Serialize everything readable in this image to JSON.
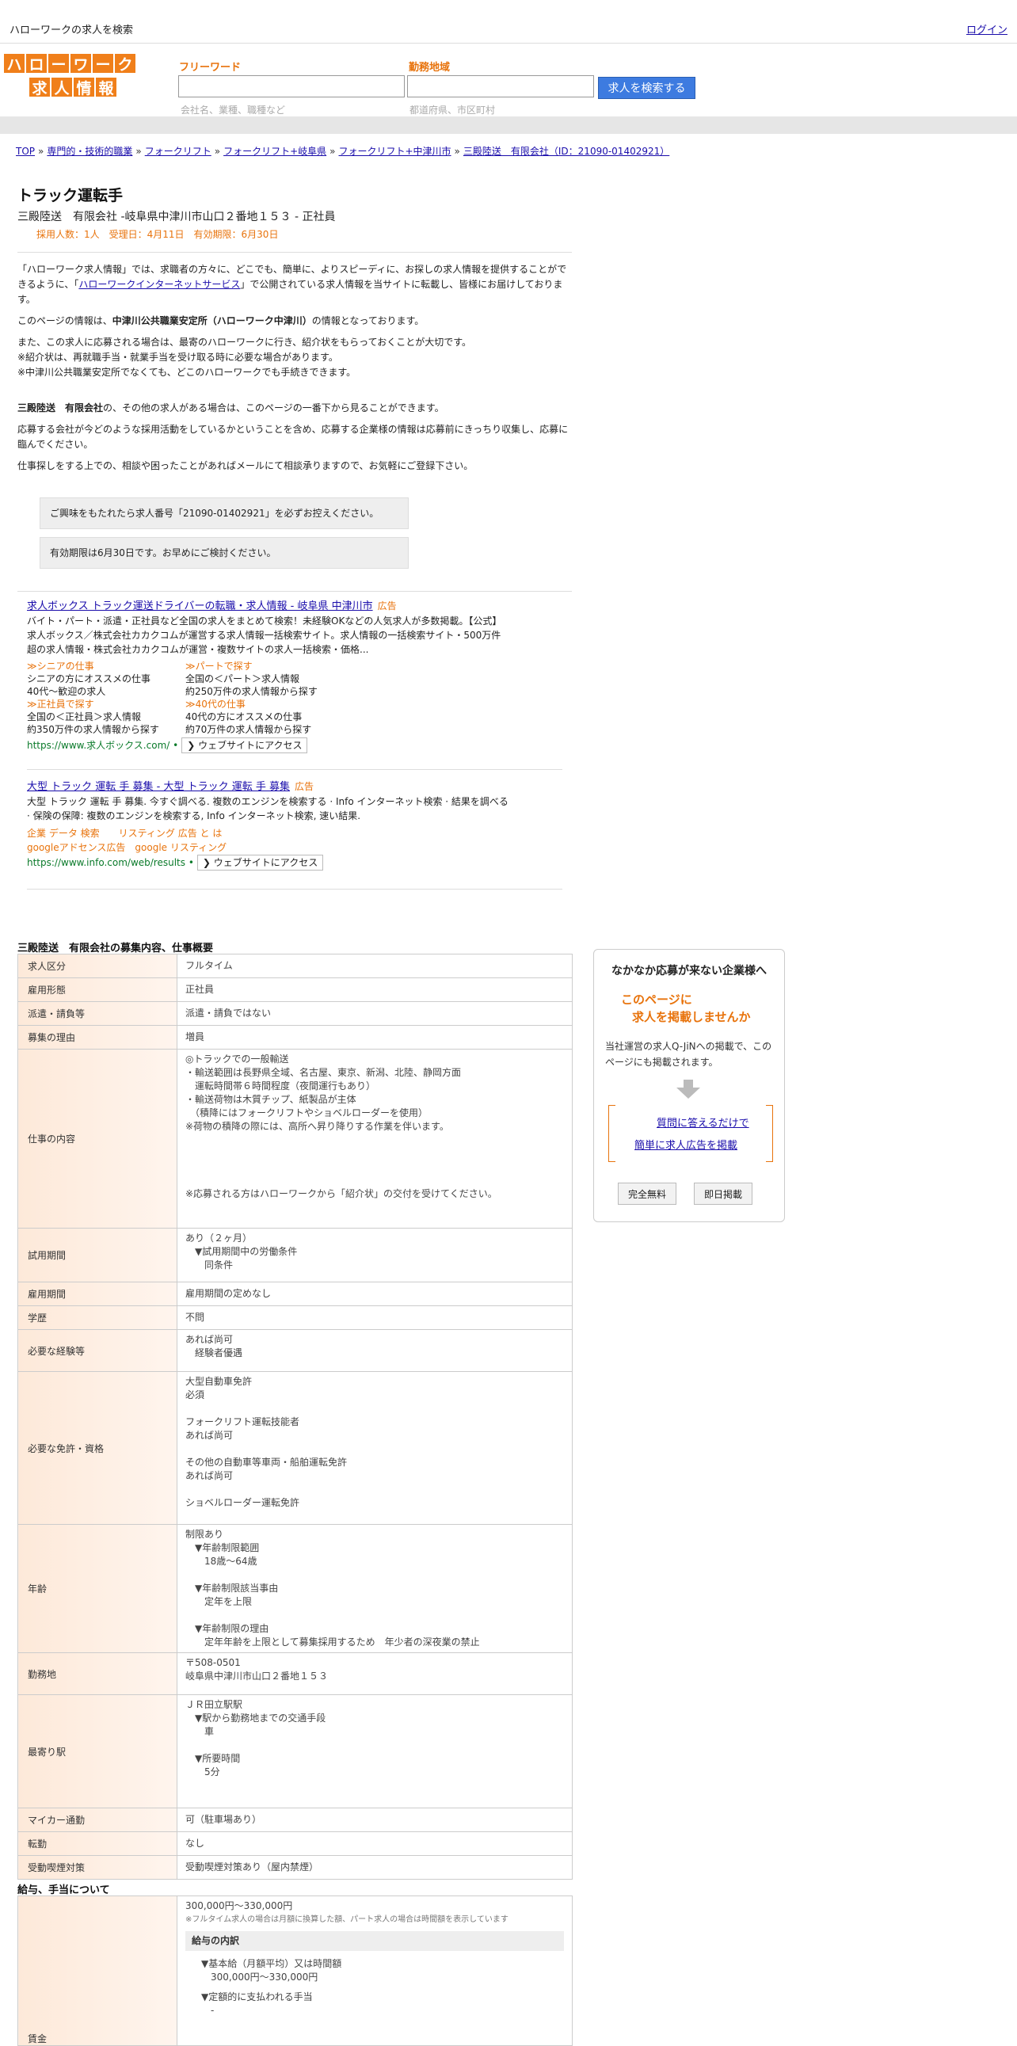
{
  "topbar": {
    "site_title": "ハローワークの求人を検索",
    "login": "ログイン"
  },
  "logo": {
    "row1": [
      "ハ",
      "ロ",
      "ー",
      "ワ",
      "ー",
      "ク"
    ],
    "row2": [
      "求",
      "人",
      "情",
      "報"
    ]
  },
  "search": {
    "freeword_label": "フリーワード",
    "freeword_hint": "会社名、業種、職種など",
    "area_label": "勤務地域",
    "area_hint": "都道府県、市区町村",
    "button": "求人を検索する"
  },
  "breadcrumb": [
    "TOP",
    "専門的・技術的職業",
    "フォークリフト",
    "フォークリフト+岐阜県",
    "フォークリフト+中津川市",
    "三殿陸送　有限会社（ID：21090-01402921）"
  ],
  "breadcrumb_sep": "»",
  "job": {
    "title": "トラック運転手",
    "subtitle": "三殿陸送　有限会社 -岐阜県中津川市山口２番地１５３ - 正社員",
    "meta": "採用人数：1人　受理日：4月11日　有効期限：6月30日"
  },
  "intro": {
    "p1a": "「ハローワーク求人情報」では、求職者の方々に、どこでも、簡単に、よりスピーディに、お探しの求人情報を提供することができるように、「",
    "p1link": "ハローワークインターネットサービス",
    "p1b": "」で公開されている求人情報を当サイトに転載し、皆様にお届けしております。",
    "p2a": "このページの情報は、",
    "p2bold": "中津川公共職業安定所（ハローワーク中津川）",
    "p2b": "の情報となっております。",
    "p3": [
      "また、この求人に応募される場合は、最寄のハローワークに行き、紹介状をもらっておくことが大切です。",
      "※紹介状は、再就職手当・就業手当を受け取る時に必要な場合があります。",
      "※中津川公共職業安定所でなくても、どこのハローワークでも手続きできます。"
    ],
    "p4bold": "三殿陸送　有限会社",
    "p4": "の、その他の求人がある場合は、このページの一番下から見ることができます。",
    "p5": "応募する会社が今どのような採用活動をしているかということを含め、応募する企業様の情報は応募前にきっちり収集し、応募に臨んでください。",
    "p6": "仕事探しをする上での、相談や困ったことがあればメールにて相談承りますので、お気軽にご登録下さい。"
  },
  "notices": [
    "ご興味をもたれたら求人番号「21090-01402921」を必ずお控えください。",
    "有効期限は6月30日です。お早めにご検討ください。"
  ],
  "ads": [
    {
      "title": "求人ボックス トラック運送ドライバーの転職・求人情報 - 岐阜県 中津川市",
      "tag": "広告",
      "desc": "バイト・パート・派遣・正社員など全国の求人をまとめて検索！未経験OKなどの人気求人が多数掲載。【公式】求人ボックス／株式会社カカクコムが運営する求人情報一括検索サイト。求人情報の一括検索サイト・500万件超の求人情報・株式会社カカクコムが運営・複数サイトの求人一括検索・価格...",
      "sitelinks": [
        {
          "link": "≫シニアの仕事",
          "l1": "シニアの方にオススメの仕事",
          "l2": "40代～歓迎の求人"
        },
        {
          "link": "≫パートで探す",
          "l1": "全国の＜パート＞求人情報",
          "l2": "約250万件の求人情報から探す"
        },
        {
          "link": "≫正社員で探す",
          "l1": "全国の＜正社員＞求人情報",
          "l2": "約350万件の求人情報から探す"
        },
        {
          "link": "≫40代の仕事",
          "l1": "40代の方にオススメの仕事",
          "l2": "約70万件の求人情報から探す"
        }
      ],
      "url": "https://www.求人ボックス.com/",
      "visit": "❯ ウェブサイトにアクセス"
    },
    {
      "title": "大型 トラック 運転 手 募集 - 大型 トラック 運転 手 募集",
      "tag": "広告",
      "desc": "大型 トラック 運転 手 募集. 今すぐ調べる. 複数のエンジンを検索する · Info インターネット検索 · 結果を調べる · 保険の保障: 複数のエンジンを検索する, Info インターネット検索, 速い結果.",
      "links1": "企業 データ 検索　　リスティング 広告 と は",
      "links2": "googleアドセンス広告　google リスティング",
      "url": "https://www.info.com/web/results",
      "visit": "❯ ウェブサイトにアクセス"
    }
  ],
  "details_title": "三殿陸送　有限会社の募集内容、仕事概要",
  "details": [
    {
      "label": "求人区分",
      "value": "フルタイム"
    },
    {
      "label": "雇用形態",
      "value": "正社員"
    },
    {
      "label": "派遣・請負等",
      "value": "派遣・請負ではない"
    },
    {
      "label": "募集の理由",
      "value": "増員"
    },
    {
      "label": "仕事の内容",
      "value": "◎トラックでの一般輸送\n・輸送範囲は長野県全域、名古屋、東京、新潟、北陸、静岡方面\n　運転時間帯６時間程度（夜間運行もあり）\n・輸送荷物は木質チップ、紙製品が主体\n　（積降にはフォークリフトやショベルローダーを使用）\n※荷物の積降の際には、高所へ昇り降りする作業を伴います。\n\n\n\n\n※応募される方はハローワークから「紹介状」の交付を受けてください。"
    },
    {
      "label": "試用期間",
      "value": "あり（２ヶ月）\n　▼試用期間中の労働条件\n　　同条件"
    },
    {
      "label": "雇用期間",
      "value": "雇用期間の定めなし"
    },
    {
      "label": "学歴",
      "value": "不問"
    },
    {
      "label": "必要な経験等",
      "value": "あれば尚可\n　経験者優遇"
    },
    {
      "label": "必要な免許・資格",
      "value": "大型自動車免許\n必須\n\nフォークリフト運転技能者\nあれば尚可\n\nその他の自動車等車両・船舶運転免許\nあれば尚可\n\nショベルローダー運転免許"
    },
    {
      "label": "年齢",
      "value": "制限あり\n　▼年齢制限範囲\n　　18歳〜64歳\n\n　▼年齢制限該当事由\n　　定年を上限\n\n　▼年齢制限の理由\n　　定年年齢を上限として募集採用するため　年少者の深夜業の禁止"
    },
    {
      "label": "勤務地",
      "value": "〒508-0501\n岐阜県中津川市山口２番地１５３"
    },
    {
      "label": "最寄り駅",
      "value": "ＪＲ田立駅駅\n　▼駅から勤務地までの交通手段\n　　車\n\n　▼所要時間\n　　5分"
    },
    {
      "label": "マイカー通勤",
      "value": "可（駐車場あり）"
    },
    {
      "label": "転勤",
      "value": "なし"
    },
    {
      "label": "受動喫煙対策",
      "value": "受動喫煙対策あり（屋内禁煙）"
    }
  ],
  "salary_title": "給与、手当について",
  "salary": {
    "label": "賃金",
    "range": "300,000円〜330,000円",
    "note": "※フルタイム求人の場合は月額に換算した額、パート求人の場合は時間額を表示しています",
    "breakdown_title": "給与の内訳",
    "items": [
      "▼基本給（月額平均）又は時間額",
      "　300,000円〜330,000円",
      "▼定額的に支払われる手当",
      "　-"
    ]
  },
  "sidebox": {
    "title": "なかなか応募が来ない企業様へ",
    "head1": "このページに",
    "head2": "求人を掲載しませんか",
    "text": "当社運営の求人Q-JiNへの掲載で、このページにも掲載されます。",
    "link1": "質問に答えるだけで",
    "link2": "簡単に求人広告を掲載",
    "btn1": "完全無料",
    "btn2": "即日掲載"
  },
  "colors": {
    "accent": "#e8730c",
    "logo": "#f07f1a",
    "button": "#3d7be0",
    "link": "#1a0dab"
  }
}
